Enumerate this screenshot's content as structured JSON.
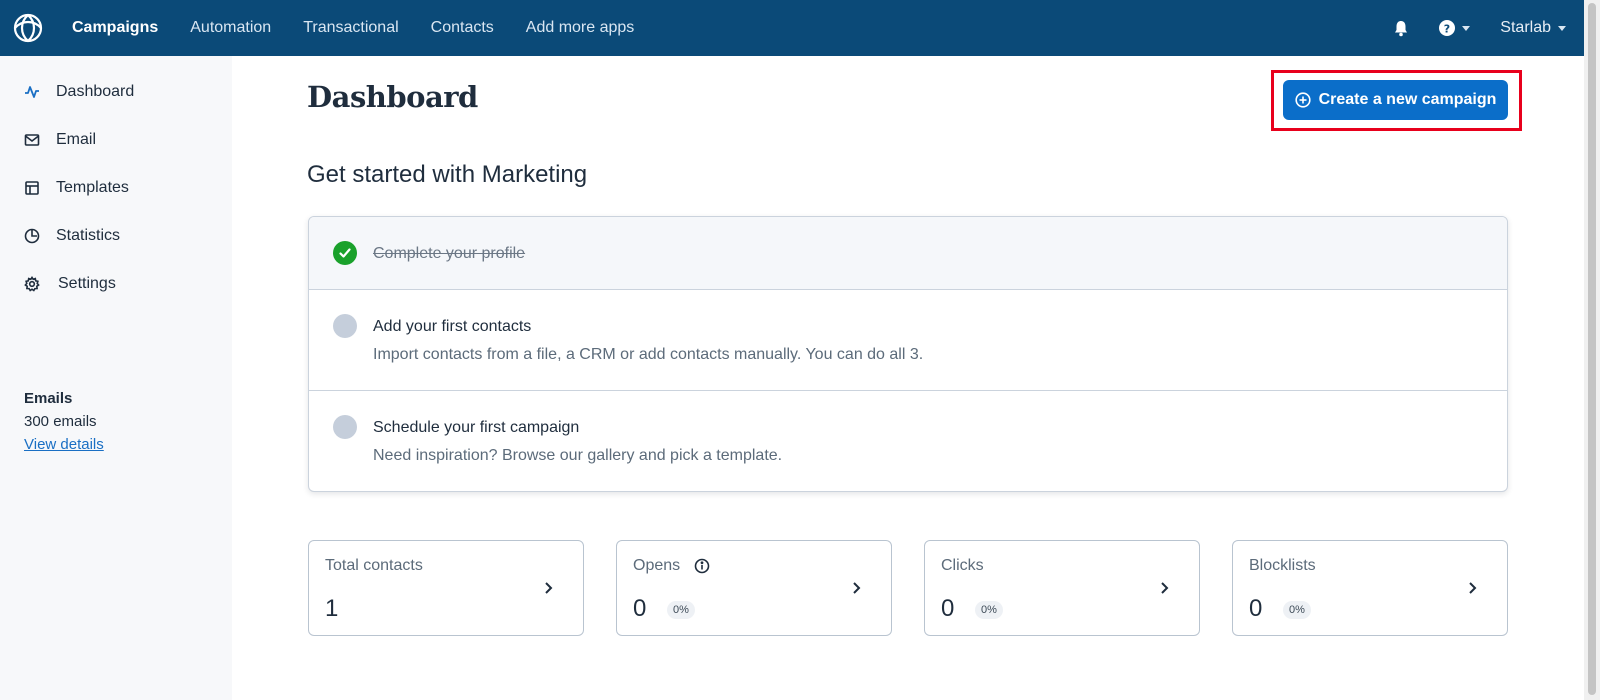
{
  "topbar": {
    "nav": [
      "Campaigns",
      "Automation",
      "Transactional",
      "Contacts",
      "Add more apps"
    ],
    "account": "Starlab",
    "icons": [
      "sendinblue-logo-icon",
      "bell-icon",
      "help-icon"
    ]
  },
  "sidebar": {
    "items": [
      {
        "label": "Dashboard",
        "icon": "activity-icon"
      },
      {
        "label": "Email",
        "icon": "envelope-icon"
      },
      {
        "label": "Templates",
        "icon": "template-icon"
      },
      {
        "label": "Statistics",
        "icon": "pie-chart-icon"
      },
      {
        "label": "Settings",
        "icon": "gear-icon"
      }
    ],
    "emails": {
      "title": "Emails",
      "count": "300 emails",
      "link": "View details"
    }
  },
  "main": {
    "title": "Dashboard",
    "create_button": "Create a new campaign",
    "section_title": "Get started with Marketing",
    "steps": [
      {
        "title": "Complete your profile",
        "desc": "",
        "done": true
      },
      {
        "title": "Add your first contacts",
        "desc": "Import contacts from a file, a CRM or add contacts manually. You can do all 3.",
        "done": false
      },
      {
        "title": "Schedule your first campaign",
        "desc": "Need inspiration? Browse our gallery and pick a template.",
        "done": false
      }
    ],
    "stats": [
      {
        "label": "Total contacts",
        "value": "1",
        "pct": ""
      },
      {
        "label": "Opens",
        "value": "0",
        "pct": "0%"
      },
      {
        "label": "Clicks",
        "value": "0",
        "pct": "0%"
      },
      {
        "label": "Blocklists",
        "value": "0",
        "pct": "0%"
      }
    ]
  },
  "colors": {
    "topbar": "#0b4a78",
    "primary_button": "#0b6ec9",
    "highlight_border": "#e8001c",
    "done_check": "#1aa12b"
  }
}
